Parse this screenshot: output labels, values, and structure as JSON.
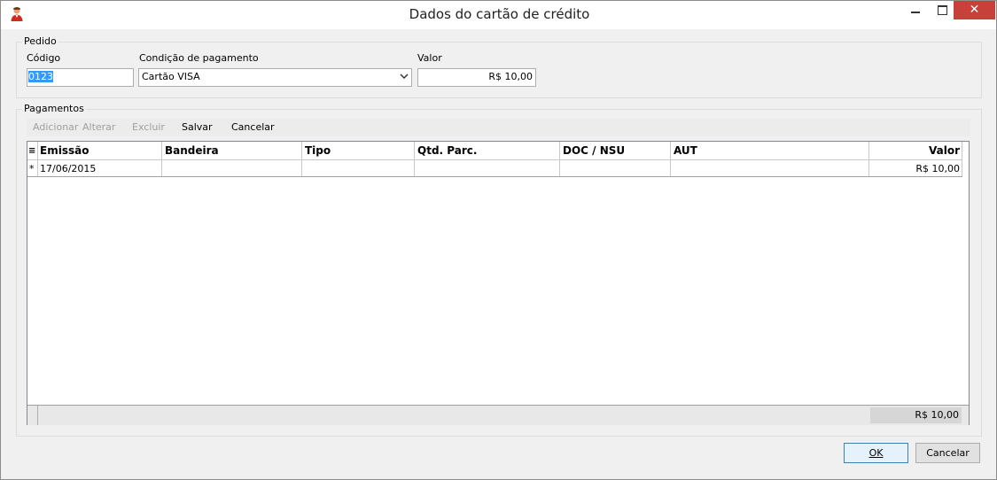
{
  "window": {
    "title": "Dados do cartão de crédito",
    "close_glyph": "✕"
  },
  "pedido": {
    "legend": "Pedido",
    "codigo_label": "Código",
    "codigo_value": "0123",
    "condicao_label": "Condição de pagamento",
    "condicao_value": "Cartão VISA",
    "valor_label": "Valor",
    "valor_value": "R$ 10,00"
  },
  "pagamentos": {
    "legend": "Pagamentos",
    "toolbar": {
      "adicionar": "Adicionar",
      "alterar": "Alterar",
      "excluir": "Excluir",
      "salvar": "Salvar",
      "cancelar": "Cancelar"
    },
    "columns": [
      "Emissão",
      "Bandeira",
      "Tipo",
      "Qtd. Parc.",
      "DOC / NSU",
      "AUT",
      "Valor"
    ],
    "row_indicator": "*",
    "header_indicator": "≡",
    "rows": [
      {
        "emissao": "17/06/2015",
        "bandeira": "",
        "tipo": "",
        "qtd_parc": "",
        "doc_nsu": "",
        "aut": "",
        "valor": "R$ 10,00"
      }
    ],
    "total": "R$ 10,00"
  },
  "buttons": {
    "ok": "OK",
    "cancelar": "Cancelar"
  },
  "icons": {
    "app": "user-icon",
    "accent_close": "#c7413a",
    "selection": "#3399ff"
  }
}
